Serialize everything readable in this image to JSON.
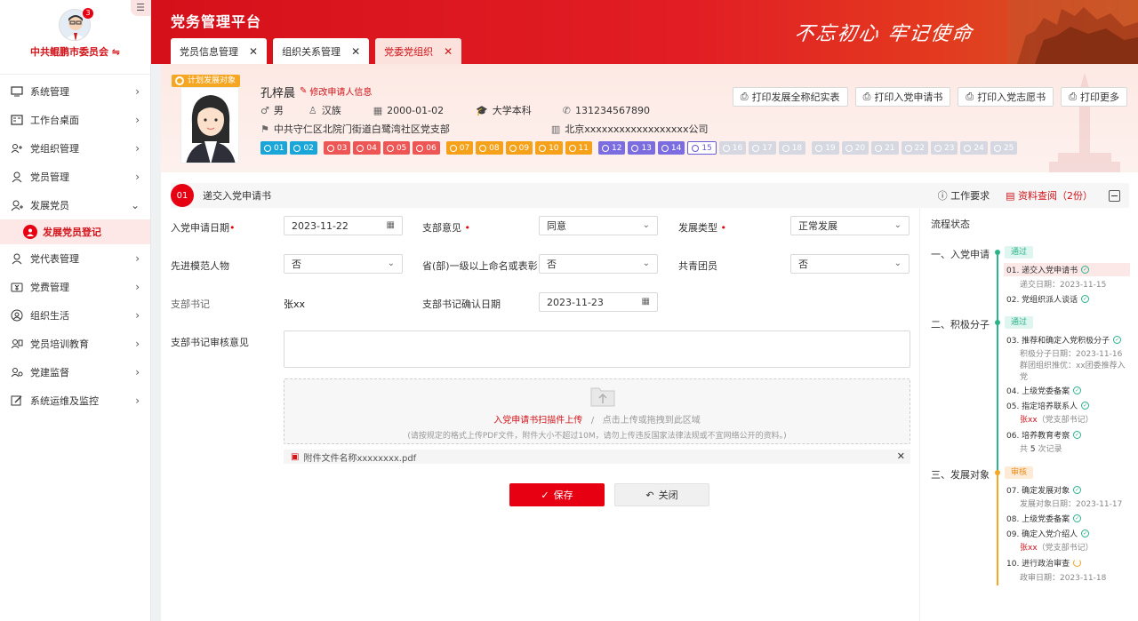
{
  "app": {
    "title": "党务管理平台",
    "slogan": "不忘初心 牢记使命"
  },
  "user": {
    "org_name": "中共鲲鹏市委员会 ⇋",
    "notifications": "3"
  },
  "sidebar": {
    "items": [
      {
        "label": "系统管理",
        "icon": "monitor-icon"
      },
      {
        "label": "工作台桌面",
        "icon": "dashboard-icon"
      },
      {
        "label": "党组织管理",
        "icon": "org-icon"
      },
      {
        "label": "党员管理",
        "icon": "user-icon"
      },
      {
        "label": "发展党员",
        "icon": "user-add-icon"
      },
      {
        "label": "发展党员登记",
        "icon": "user-register-icon",
        "active": true
      },
      {
        "label": "党代表管理",
        "icon": "user-icon"
      },
      {
        "label": "党费管理",
        "icon": "money-icon"
      },
      {
        "label": "组织生活",
        "icon": "group-icon"
      },
      {
        "label": "党员培训教育",
        "icon": "training-icon"
      },
      {
        "label": "党建监督",
        "icon": "supervise-icon"
      },
      {
        "label": "系统运维及监控",
        "icon": "ops-icon"
      }
    ]
  },
  "tabs": [
    {
      "label": "党员信息管理",
      "active": false
    },
    {
      "label": "组织关系管理",
      "active": false
    },
    {
      "label": "党委党组织",
      "active": true
    }
  ],
  "profile": {
    "plan_tag": "计划发展对象",
    "name": "孔梓晨",
    "edit_link": "修改申请人信息",
    "gender": "男",
    "ethnicity": "汉族",
    "birth": "2000-01-02",
    "education": "大学本科",
    "phone": "131234567890",
    "branch": "中共守仁区北院门街道白鹭湾社区党支部",
    "company": "北京xxxxxxxxxxxxxxxxxx公司",
    "steps": [
      {
        "n": "01",
        "color": "#1ba6d9",
        "state": "done"
      },
      {
        "n": "02",
        "color": "#1ba6d9",
        "state": "done"
      },
      {
        "n": "03",
        "color": "#ee5656",
        "state": "done"
      },
      {
        "n": "04",
        "color": "#ee5656",
        "state": "done"
      },
      {
        "n": "05",
        "color": "#ee5656",
        "state": "done"
      },
      {
        "n": "06",
        "color": "#ee5656",
        "state": "done"
      },
      {
        "n": "07",
        "color": "#f5a11a",
        "state": "done"
      },
      {
        "n": "08",
        "color": "#f5a11a",
        "state": "done"
      },
      {
        "n": "09",
        "color": "#f5a11a",
        "state": "done"
      },
      {
        "n": "10",
        "color": "#f5a11a",
        "state": "done"
      },
      {
        "n": "11",
        "color": "#f5a11a",
        "state": "done"
      },
      {
        "n": "12",
        "color": "#7b6ce0",
        "state": "done"
      },
      {
        "n": "13",
        "color": "#7b6ce0",
        "state": "done"
      },
      {
        "n": "14",
        "color": "#7b6ce0",
        "state": "done"
      },
      {
        "n": "15",
        "color": "#ffffff",
        "state": "current"
      },
      {
        "n": "16",
        "color": "#d5d8e0",
        "state": "todo"
      },
      {
        "n": "17",
        "color": "#d5d8e0",
        "state": "todo"
      },
      {
        "n": "18",
        "color": "#d5d8e0",
        "state": "todo"
      },
      {
        "n": "19",
        "color": "#d5d8e0",
        "state": "todo"
      },
      {
        "n": "20",
        "color": "#d5d8e0",
        "state": "todo"
      },
      {
        "n": "21",
        "color": "#d5d8e0",
        "state": "todo"
      },
      {
        "n": "22",
        "color": "#d5d8e0",
        "state": "todo"
      },
      {
        "n": "23",
        "color": "#d5d8e0",
        "state": "todo"
      },
      {
        "n": "24",
        "color": "#d5d8e0",
        "state": "todo"
      },
      {
        "n": "25",
        "color": "#d5d8e0",
        "state": "todo"
      }
    ],
    "print_buttons": [
      "打印发展全称纪实表",
      "打印入党申请书",
      "打印入党志愿书",
      "打印更多"
    ]
  },
  "section": {
    "num": "01",
    "title": "递交入党申请书",
    "requirement": "工作要求",
    "docs": "资料查阅（2份）"
  },
  "form": {
    "apply_date_label": "入党申请日期",
    "apply_date": "2023-11-22",
    "branch_opinion_label": "支部意见",
    "branch_opinion": "同意",
    "dev_type_label": "发展类型",
    "dev_type": "正常发展",
    "model_label": "先进模范人物",
    "model": "否",
    "honor_label": "省(部)一级以上命名或表彰",
    "honor": "否",
    "league_label": "共青团员",
    "league": "否",
    "secretary_label": "支部书记",
    "secretary": "张xx",
    "confirm_date_label": "支部书记确认日期",
    "confirm_date": "2023-11-23",
    "review_label": "支部书记审核意见",
    "upload_link": "入党申请书扫描件上传",
    "upload_sep": "/",
    "upload_drag": "点击上传或拖拽到此区域",
    "upload_hint": "(请按规定的格式上传PDF文件，附件大小不超过10M，请勿上传违反国家法律法规或不宜网络公开的资料。)",
    "attachment": "附件文件名称xxxxxxxx.pdf",
    "save": "保存",
    "close": "关闭"
  },
  "flow": {
    "title": "流程状态",
    "stages": [
      {
        "label": "一、入党申请",
        "status": "通过"
      },
      {
        "label": "二、积极分子",
        "status": "通过"
      },
      {
        "label": "三、发展对象",
        "status": "审核"
      }
    ],
    "steps": {
      "s01": "01. 递交入党申请书",
      "s01_info": "递交日期：2023-11-15",
      "s02": "02. 党组织派人谈话",
      "s03": "03. 推荐和确定入党积极分子",
      "s03_info1": "积极分子日期：2023-11-16",
      "s03_info2": "群团组织推优：xx团委推荐入",
      "s03_info3": "党",
      "s04": "04. 上级党委备案",
      "s05": "05. 指定培养联系人",
      "s05_info_name": "张xx",
      "s05_info_role": "（党支部书记）",
      "s06": "06. 培养教育考察",
      "s06_info_pre": "共",
      "s06_info_count": "5",
      "s06_info_post": "次记录",
      "s07": "07. 确定发展对象",
      "s07_info": "发展对象日期：2023-11-17",
      "s08": "08. 上级党委备案",
      "s09": "09. 确定入党介绍人",
      "s09_info_name": "张xx",
      "s09_info_role": "（党支部书记）",
      "s10": "10. 进行政治审查",
      "s10_info": "政审日期：2023-11-18"
    }
  }
}
